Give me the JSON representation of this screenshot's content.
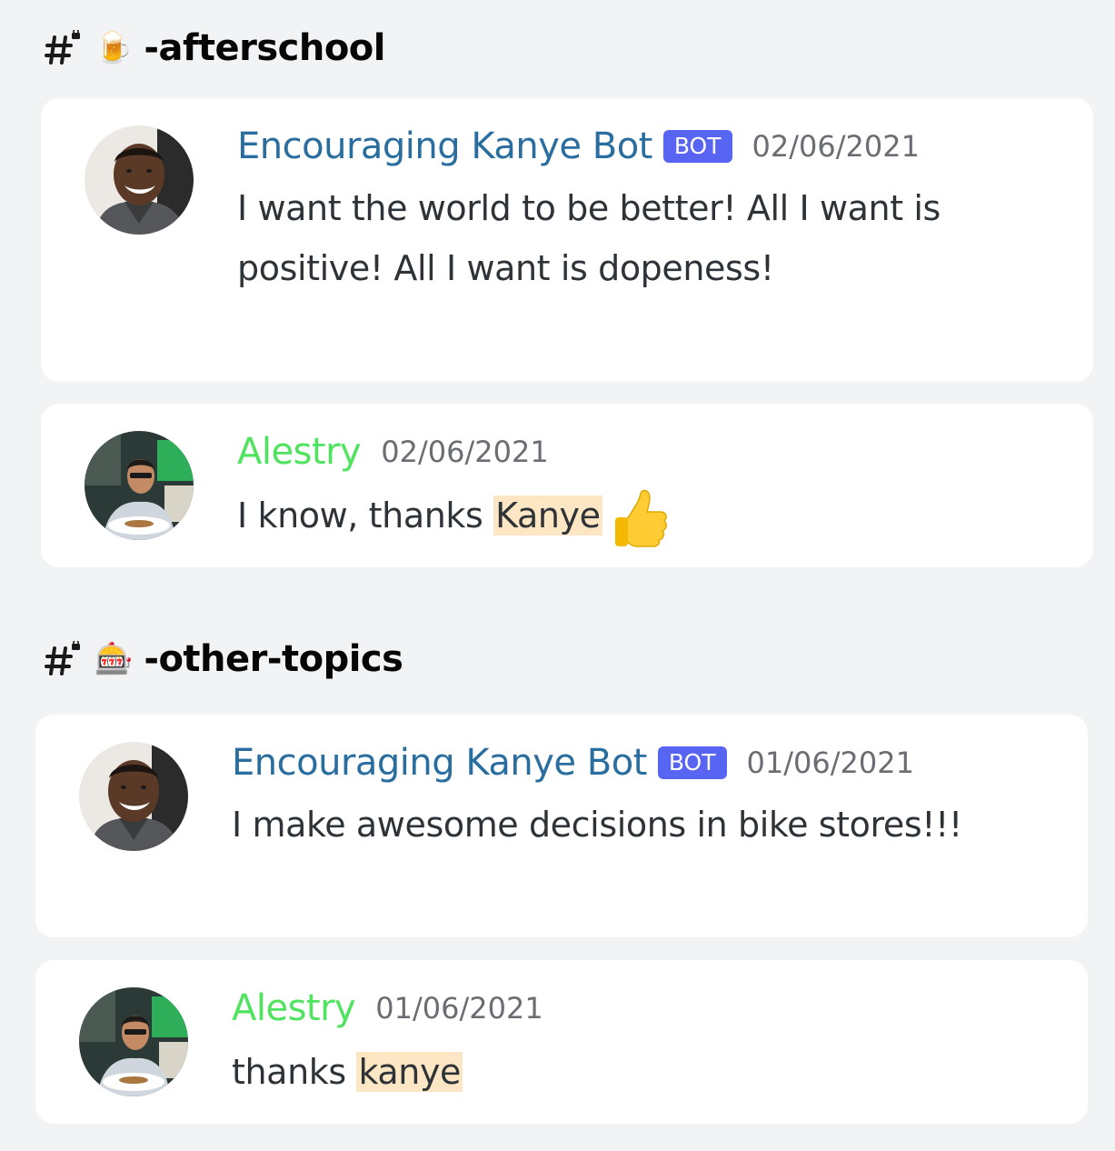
{
  "channels": [
    {
      "emoji": "🍺",
      "name": "-afterschool",
      "messages": [
        {
          "author": "Encouraging Kanye Bot",
          "badge": "BOT",
          "timestamp": "02/06/2021",
          "text": "I want the world to be better! All I want is positive! All I want is dopeness!",
          "avatar": "kanye-avatar"
        },
        {
          "author": "Alestry",
          "timestamp": "02/06/2021",
          "text_before": "I know, thanks ",
          "mention": "Kanye",
          "emoji": "thumbs-up-icon",
          "avatar": "alestry-avatar"
        }
      ]
    },
    {
      "emoji": "🎰",
      "name": "-other-topics",
      "messages": [
        {
          "author": "Encouraging Kanye Bot",
          "badge": "BOT",
          "timestamp": "01/06/2021",
          "text": "I make awesome decisions in bike stores!!!",
          "avatar": "kanye-avatar"
        },
        {
          "author": "Alestry",
          "timestamp": "01/06/2021",
          "text_before": "thanks ",
          "mention": "kanye",
          "avatar": "alestry-avatar"
        }
      ]
    }
  ],
  "colors": {
    "bot_name": "#2a6ea0",
    "user_name": "#4fe35f",
    "bot_badge": "#5865f2",
    "mention_bg": "#fde6c3",
    "background": "#f2f3f5"
  }
}
